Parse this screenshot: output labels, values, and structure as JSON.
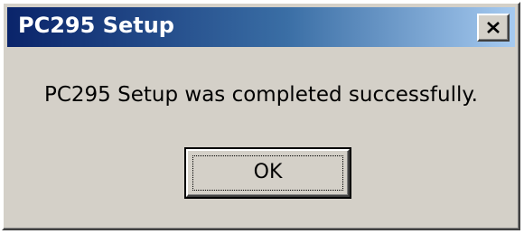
{
  "window": {
    "title": "PC295 Setup",
    "close_icon": "close-icon"
  },
  "message": {
    "text": "PC295 Setup was completed successfully."
  },
  "buttons": {
    "ok_label": "OK"
  },
  "colors": {
    "titlebar_start": "#0a246a",
    "titlebar_end": "#a6caf0",
    "dialog_face": "#d4d0c8"
  }
}
